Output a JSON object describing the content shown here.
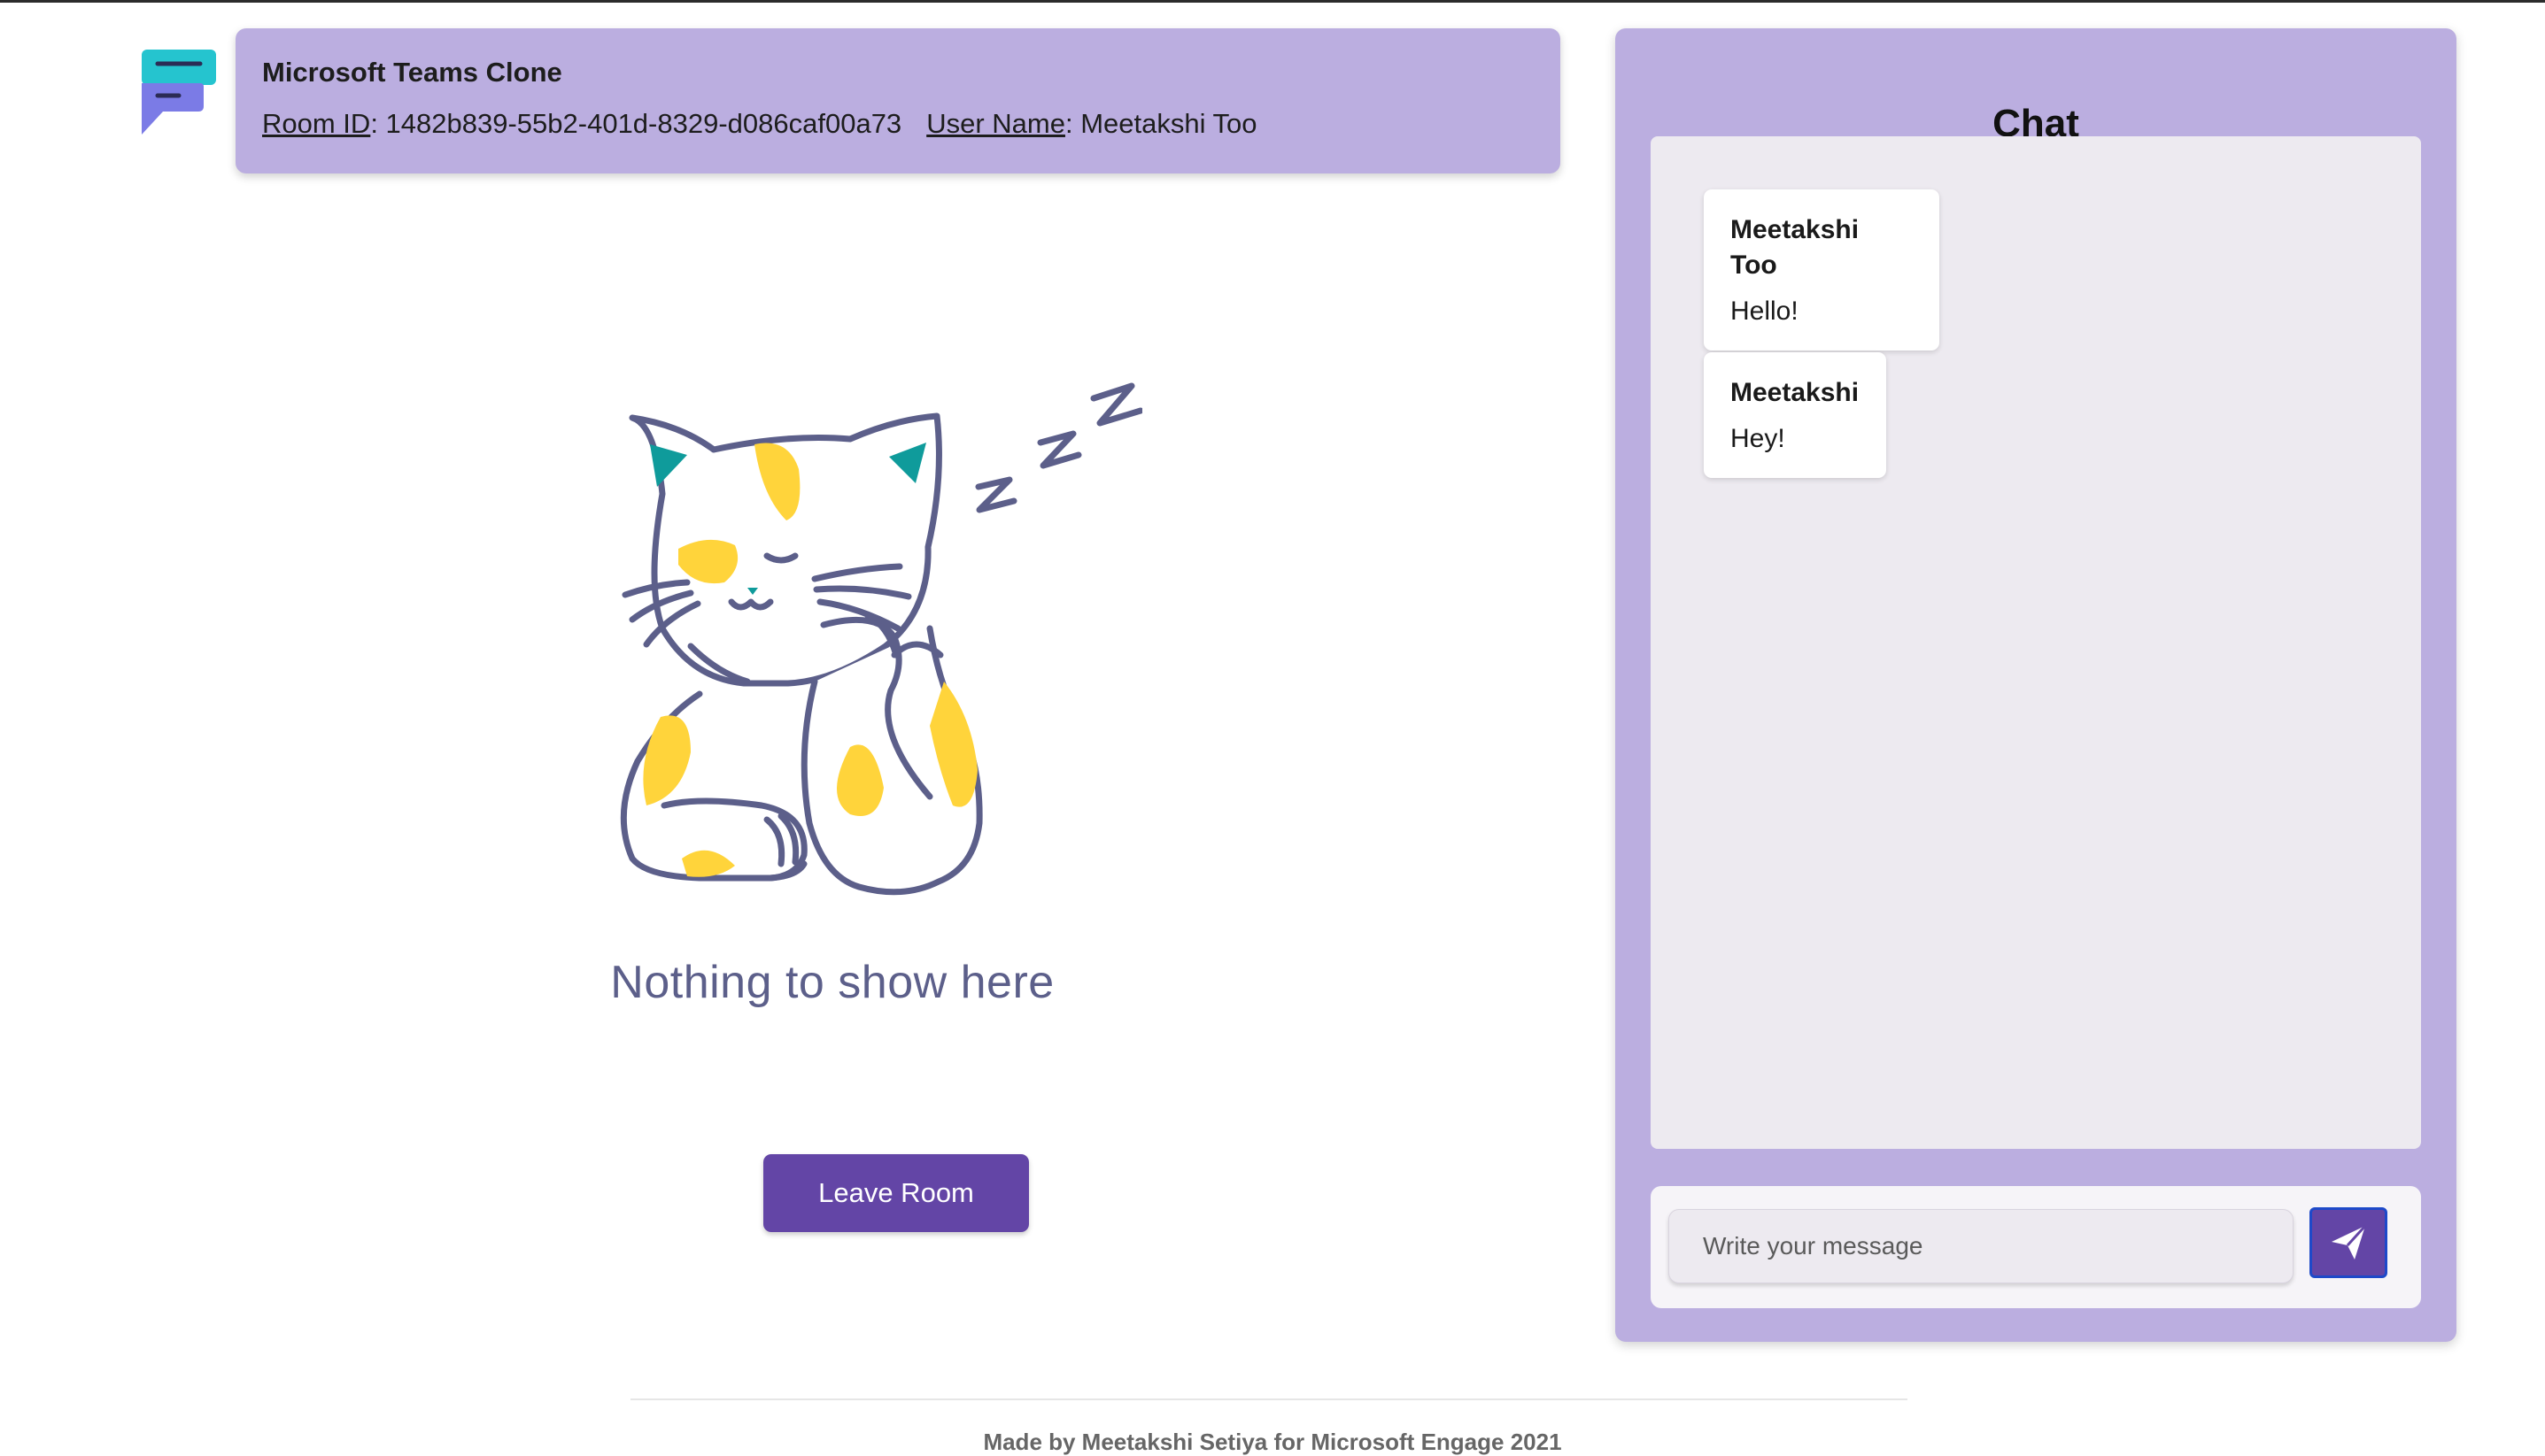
{
  "header": {
    "app_title": "Microsoft Teams Clone",
    "room_id_label": "Room ID",
    "room_id_value": "1482b839-55b2-401d-8329-d086caf00a73",
    "user_name_label": "User Name",
    "user_name_value": "Meetakshi Too"
  },
  "main": {
    "empty_text": "Nothing to show here",
    "leave_button_label": "Leave Room"
  },
  "chat": {
    "title": "Chat",
    "messages": [
      {
        "sender": "Meetakshi Too",
        "text": "Hello!"
      },
      {
        "sender": "Meetakshi",
        "text": "Hey!"
      }
    ],
    "input_placeholder": "Write your message",
    "send_icon": "paper-plane-icon"
  },
  "footer": {
    "text": "Made by Meetakshi Setiya for Microsoft Engage 2021"
  },
  "colors": {
    "accent_purple": "#6345a6",
    "panel_lavender": "#bbaee0",
    "message_area": "#edeaf0",
    "logo_teal": "#25c4cf",
    "logo_violet": "#7b7be6",
    "cat_yellow": "#ffd43b",
    "cat_teal": "#0f9b9b",
    "cat_outline": "#5c5f8a"
  }
}
